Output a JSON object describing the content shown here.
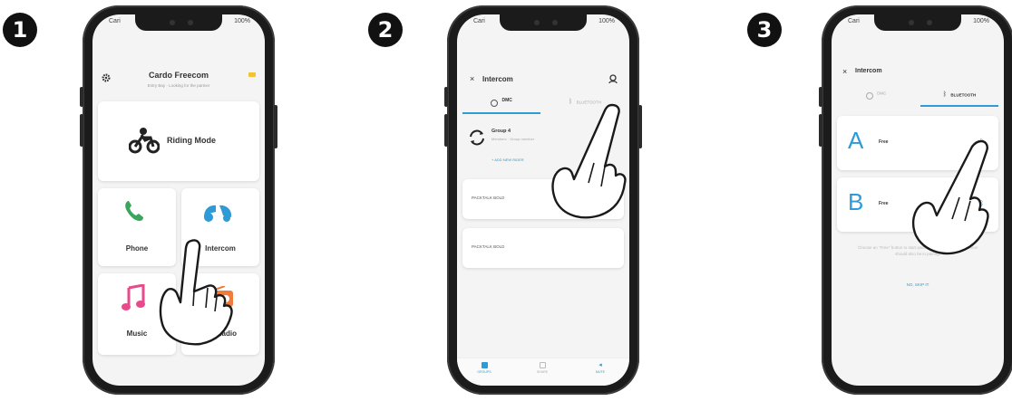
{
  "steps": [
    "1",
    "2",
    "3"
  ],
  "phone1": {
    "status_left": "Cari",
    "status_right": "100%",
    "title": "Cardo Freecom",
    "subtitle": "Entry Bay · Looking for the partner",
    "riding_mode": "Riding Mode",
    "phone": "Phone",
    "intercom": "Intercom",
    "music": "Music",
    "fm_radio": "FM Radio"
  },
  "phone2": {
    "title": "Intercom",
    "tab_dmc": "DMC",
    "tab_bluetooth": "BLUETOOTH",
    "group_name": "Group 4",
    "group_sub": "Members · Group member",
    "add_rider": "+ ADD NEW RIDER",
    "device1": "PACKTALK BOLD",
    "device2": "PACKTALK BOLD",
    "nav_group": "GROUPS",
    "nav_share": "SHARE",
    "nav_mute": "MUTE"
  },
  "phone3": {
    "title": "Intercom",
    "tab_dmc": "DMC",
    "tab_bluetooth": "BLUETOOTH",
    "slot_a_letter": "A",
    "slot_a_status": "Free",
    "slot_b_letter": "B",
    "slot_b_status": "Free",
    "help_text": "Choose an \"Free\" button to start pairing process. The other device should also be in pairing.",
    "link": "NO, SKIP IT"
  },
  "colors": {
    "accent_blue": "#2e9bd6",
    "green_phone": "#3aa55c",
    "pink_music": "#e94a8b",
    "orange_radio": "#f07b3a"
  }
}
